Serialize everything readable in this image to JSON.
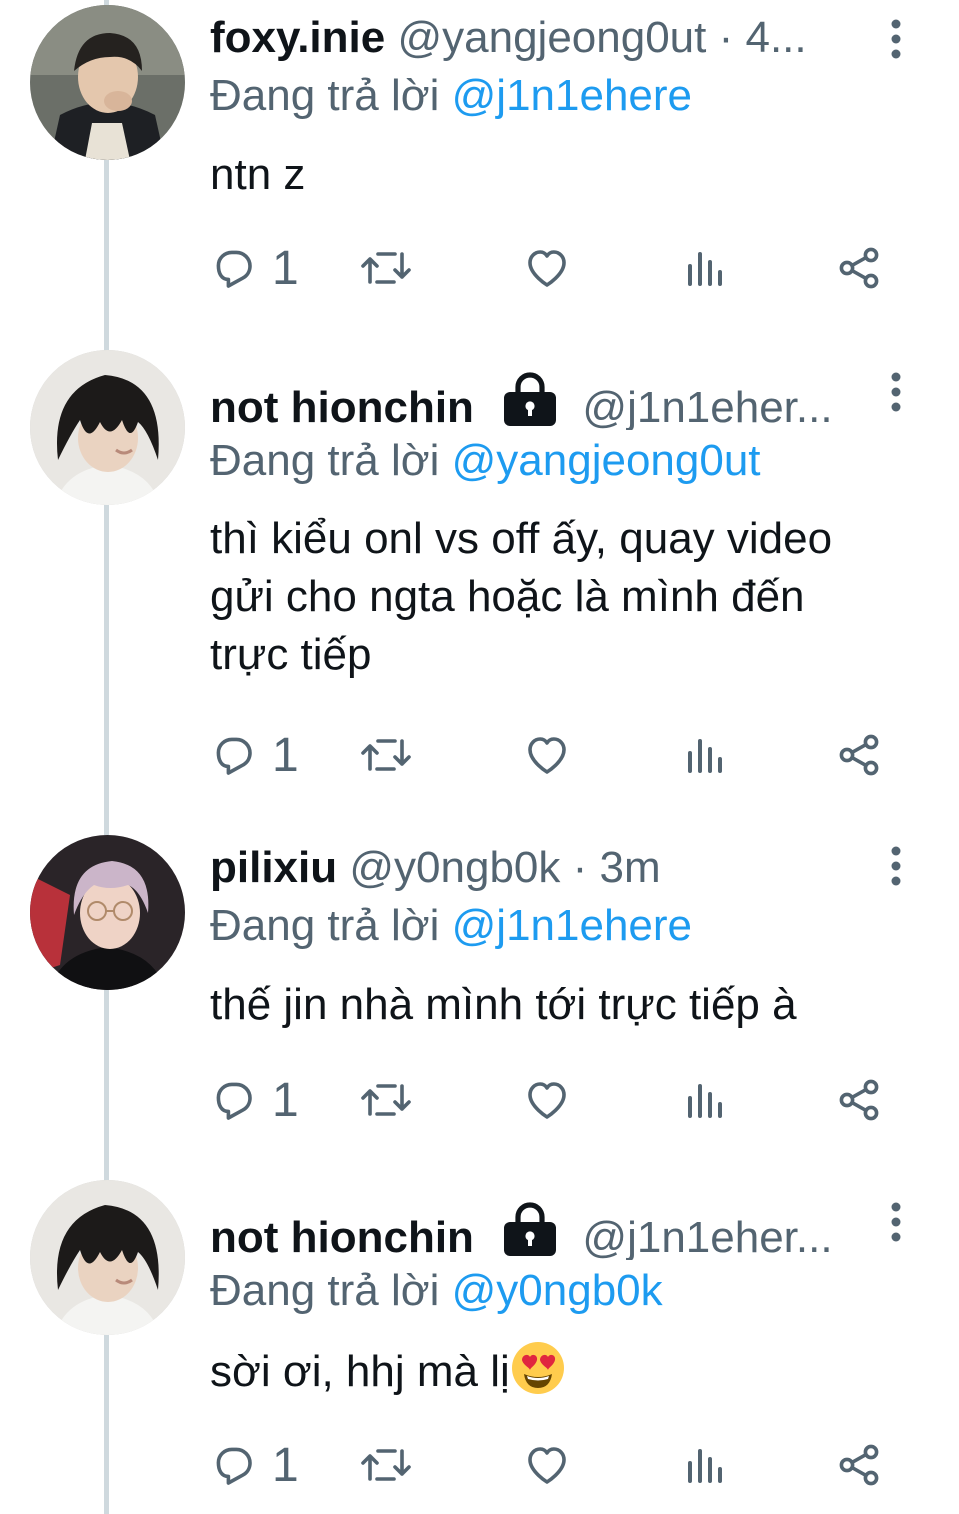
{
  "colors": {
    "text": "#0f1419",
    "secondary": "#536471",
    "link": "#1d9bf0",
    "thread_line": "#cfd9de"
  },
  "tweets": [
    {
      "name": "foxy.inie",
      "handle_meta": "@yangjeong0ut · 4...",
      "locked": false,
      "reply_prefix": "Đang trả lời",
      "reply_target": "@j1n1ehere",
      "text_lines": [
        "ntn z"
      ],
      "emoji": "",
      "reply_count": "1"
    },
    {
      "name": "not hionchin",
      "handle_meta": "@j1n1eher...",
      "locked": true,
      "reply_prefix": "Đang trả lời",
      "reply_target": "@yangjeong0ut",
      "text_lines": [
        "thì kiểu onl vs off ấy, quay video",
        "gửi cho ngta hoặc là mình đến",
        "trực tiếp"
      ],
      "emoji": "",
      "reply_count": "1"
    },
    {
      "name": "pilixiu",
      "handle_meta": "@y0ngb0k · 3m",
      "locked": false,
      "reply_prefix": "Đang trả lời",
      "reply_target": "@j1n1ehere",
      "text_lines": [
        "thế jin nhà mình tới trực tiếp à"
      ],
      "emoji": "",
      "reply_count": "1"
    },
    {
      "name": "not hionchin",
      "handle_meta": "@j1n1eher...",
      "locked": true,
      "reply_prefix": "Đang trả lời",
      "reply_target": "@y0ngb0k",
      "text_lines": [
        "sời ơi, hhj mà lị"
      ],
      "emoji": "smiling-face-with-heart-eyes",
      "reply_count": "1"
    }
  ]
}
